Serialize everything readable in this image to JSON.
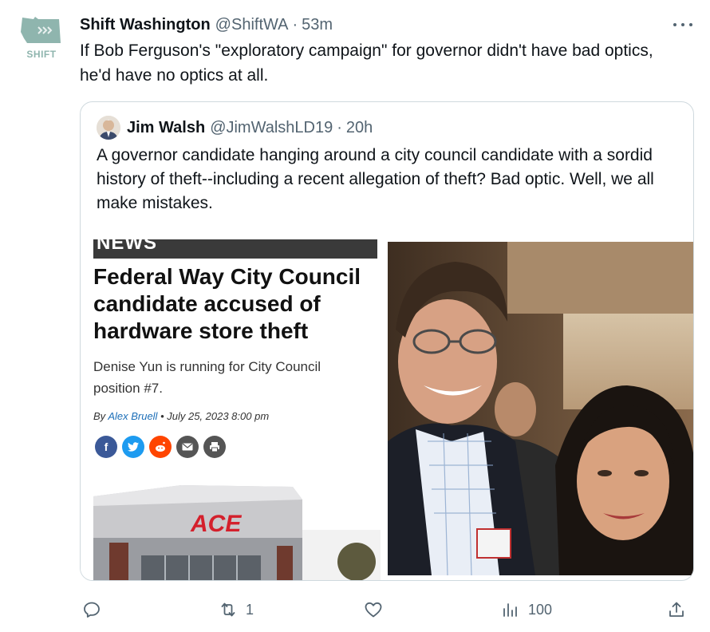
{
  "tweet": {
    "avatar_text": "SHIFT",
    "author_name": "Shift Washington",
    "handle": "@ShiftWA",
    "separator": "·",
    "time": "53m",
    "text": "If Bob Ferguson's \"exploratory campaign\" for governor didn't have bad optics, he'd have no optics at all."
  },
  "quote": {
    "author_name": "Jim Walsh",
    "handle": "@JimWalshLD19",
    "separator": "·",
    "time": "20h",
    "text": "A governor candidate hanging around a city council candidate with a sordid history of theft--including a recent allegation of theft? Bad optic. Well, we all make mistakes.",
    "article": {
      "section": "NEWS",
      "headline": "Federal Way City Council candidate accused of hardware store theft",
      "subhead": "Denise Yun is running for City Council position #7.",
      "byline_prefix": "By ",
      "byline_author": "Alex Bruell",
      "byline_date": " • July 25, 2023 8:00 pm",
      "share_icons": [
        "facebook-icon",
        "twitter-icon",
        "reddit-icon",
        "email-icon",
        "print-icon"
      ],
      "store_sign": "ACE"
    }
  },
  "actions": {
    "reply_count": "",
    "retweet_count": "1",
    "like_count": "",
    "views_count": "100"
  },
  "colors": {
    "text_primary": "#0f1419",
    "text_secondary": "#536471",
    "border": "#cfd9de",
    "shift_logo": "#8fb5ae",
    "ace_red": "#d4202c"
  }
}
